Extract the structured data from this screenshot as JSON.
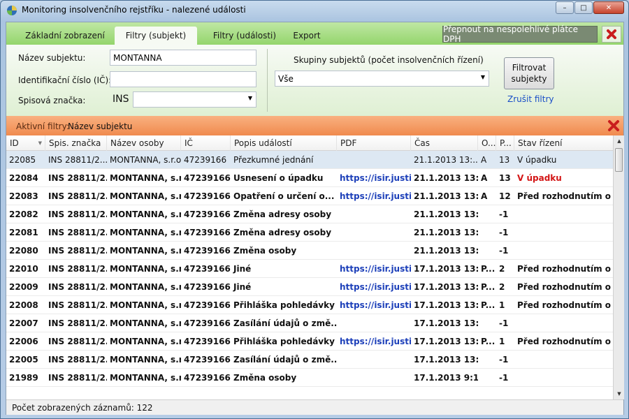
{
  "window": {
    "title": "Monitoring insolvenčního rejstříku - nalezené události",
    "controls": {
      "minimize": "–",
      "maximize": "□",
      "close": "✕"
    }
  },
  "tabs": [
    {
      "label": "Základní zobrazení",
      "active": false
    },
    {
      "label": "Filtry (subjekt)",
      "active": true
    },
    {
      "label": "Filtry (události)",
      "active": false
    },
    {
      "label": "Export",
      "active": false
    }
  ],
  "toolbar": {
    "dph_button": "Přepnout na nespolehlivé plátce DPH",
    "close_icon": "red-x-icon"
  },
  "filters": {
    "name_label": "Název subjektu:",
    "name_value": "MONTANNA",
    "ic_label": "Identifikační číslo (IČ):",
    "ic_value": "",
    "spis_label": "Spisová značka:",
    "spis_prefix": "INS",
    "spis_value": "",
    "groups_label": "Skupiny subjektů (počet insolvenčních řízení)",
    "groups_value": "Vše",
    "filter_button": "Filtrovat subjekty",
    "cancel_link": "Zrušit filtry"
  },
  "active_filters": {
    "label": "Aktivní filtry:",
    "value": "Název subjektu"
  },
  "grid": {
    "columns": [
      "ID",
      "Spis. značka",
      "Název osoby",
      "IČ",
      "Popis událostí",
      "PDF",
      "Čas",
      "O...",
      "P...",
      "Stav řízení"
    ],
    "rows": [
      {
        "id": "22085",
        "spis": "INS 28811/2...",
        "name": "MONTANNA, s.r.o.",
        "ic": "47239166",
        "popis": "Přezkumné jednání",
        "pdf": "",
        "cas": "21.1.2013 13:...",
        "o": "A",
        "p": "13",
        "stav": "V úpadku",
        "stav_red": false,
        "selected": true
      },
      {
        "id": "22084",
        "spis": "INS 28811/2...",
        "name": "MONTANNA, s.r.o.",
        "ic": "47239166",
        "popis": "Usnesení o úpadku",
        "pdf": "https://isir.justic...",
        "cas": "21.1.2013 13:...",
        "o": "A",
        "p": "13",
        "stav": "V úpadku",
        "stav_red": true,
        "selected": false
      },
      {
        "id": "22083",
        "spis": "INS 28811/2...",
        "name": "MONTANNA, s.r.o.",
        "ic": "47239166",
        "popis": "Opatření o určení o...",
        "pdf": "https://isir.justic...",
        "cas": "21.1.2013 13:...",
        "o": "A",
        "p": "12",
        "stav": "Před rozhodnutím o ú...",
        "stav_red": false,
        "selected": false
      },
      {
        "id": "22082",
        "spis": "INS 28811/2...",
        "name": "MONTANNA, s.r.o.",
        "ic": "47239166",
        "popis": "Změna adresy osoby",
        "pdf": "",
        "cas": "21.1.2013 13:...",
        "o": "",
        "p": "-1",
        "stav": "",
        "stav_red": false,
        "selected": false
      },
      {
        "id": "22081",
        "spis": "INS 28811/2...",
        "name": "MONTANNA, s.r.o.",
        "ic": "47239166",
        "popis": "Změna adresy osoby",
        "pdf": "",
        "cas": "21.1.2013 13:...",
        "o": "",
        "p": "-1",
        "stav": "",
        "stav_red": false,
        "selected": false
      },
      {
        "id": "22080",
        "spis": "INS 28811/2...",
        "name": "MONTANNA, s.r.o.",
        "ic": "47239166",
        "popis": "Změna osoby",
        "pdf": "",
        "cas": "21.1.2013 13:...",
        "o": "",
        "p": "-1",
        "stav": "",
        "stav_red": false,
        "selected": false
      },
      {
        "id": "22010",
        "spis": "INS 28811/2...",
        "name": "MONTANNA, s.r.o.",
        "ic": "47239166",
        "popis": "Jiné",
        "pdf": "https://isir.justic...",
        "cas": "17.1.2013 13:...",
        "o": "P...",
        "p": "2",
        "stav": "Před rozhodnutím o ú...",
        "stav_red": false,
        "selected": false
      },
      {
        "id": "22009",
        "spis": "INS 28811/2...",
        "name": "MONTANNA, s.r.o.",
        "ic": "47239166",
        "popis": "Jiné",
        "pdf": "https://isir.justic...",
        "cas": "17.1.2013 13:...",
        "o": "P...",
        "p": "2",
        "stav": "Před rozhodnutím o ú...",
        "stav_red": false,
        "selected": false
      },
      {
        "id": "22008",
        "spis": "INS 28811/2...",
        "name": "MONTANNA, s.r.o.",
        "ic": "47239166",
        "popis": "Přihláška pohledávky",
        "pdf": "https://isir.justic...",
        "cas": "17.1.2013 13:...",
        "o": "P...",
        "p": "1",
        "stav": "Před rozhodnutím o ú...",
        "stav_red": false,
        "selected": false
      },
      {
        "id": "22007",
        "spis": "INS 28811/2...",
        "name": "MONTANNA, s.r.o.",
        "ic": "47239166",
        "popis": "Zasílání údajů o změ...",
        "pdf": "",
        "cas": "17.1.2013 13:...",
        "o": "",
        "p": "-1",
        "stav": "",
        "stav_red": false,
        "selected": false
      },
      {
        "id": "22006",
        "spis": "INS 28811/2...",
        "name": "MONTANNA, s.r.o.",
        "ic": "47239166",
        "popis": "Přihláška pohledávky",
        "pdf": "https://isir.justic...",
        "cas": "17.1.2013 13:...",
        "o": "P...",
        "p": "1",
        "stav": "Před rozhodnutím o ú...",
        "stav_red": false,
        "selected": false
      },
      {
        "id": "22005",
        "spis": "INS 28811/2...",
        "name": "MONTANNA, s.r.o.",
        "ic": "47239166",
        "popis": "Zasílání údajů o změ...",
        "pdf": "",
        "cas": "17.1.2013 13:...",
        "o": "",
        "p": "-1",
        "stav": "",
        "stav_red": false,
        "selected": false
      },
      {
        "id": "21989",
        "spis": "INS 28811/2...",
        "name": "MONTANNA, s.r.o.",
        "ic": "47239166",
        "popis": "Změna osoby",
        "pdf": "",
        "cas": "17.1.2013 9:1...",
        "o": "",
        "p": "-1",
        "stav": "",
        "stav_red": false,
        "selected": false
      }
    ]
  },
  "status": {
    "text": "Počet zobrazených záznamů: 122"
  },
  "colors": {
    "tab_strip": "#94d56c",
    "active_bar": "#f08a4e",
    "link": "#1c3fb9",
    "status_red": "#d31515",
    "selected_row": "#dde8f3"
  }
}
